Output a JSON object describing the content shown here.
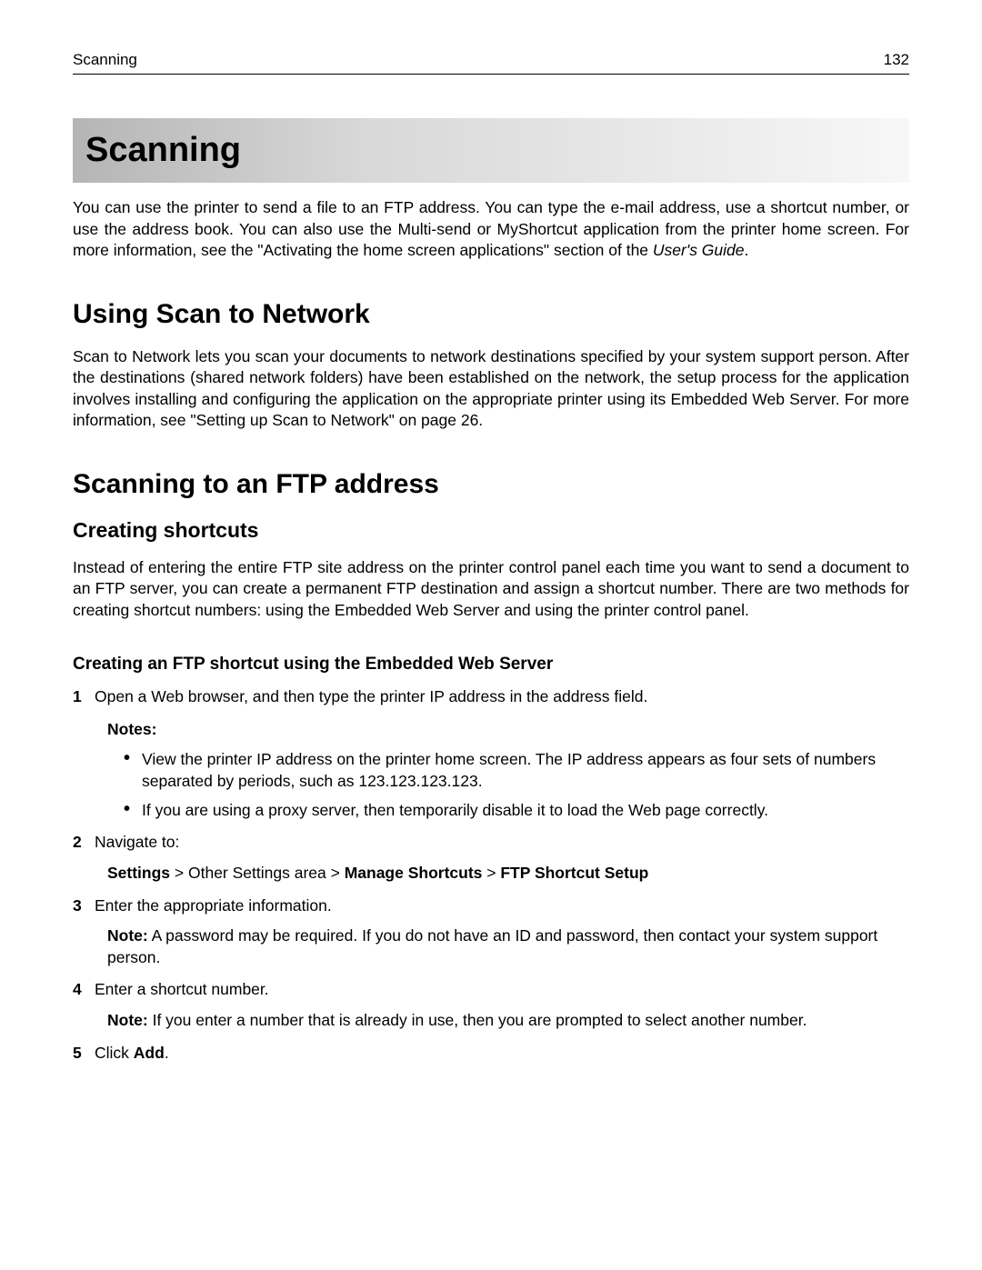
{
  "header": {
    "section": "Scanning",
    "page_number": "132"
  },
  "chapter_title": "Scanning",
  "intro_a": "You can use the printer to send a file to an FTP address. You can type the e‑mail address, use a shortcut number, or use the address book. You can also use the Multi‑send or MyShortcut application from the printer home screen. For more information, see the \"Activating the home screen applications\" section of the ",
  "intro_italic": "User's Guide",
  "intro_b": ".",
  "h1_a": "Using Scan to Network",
  "para_a": "Scan to Network lets you scan your documents to network destinations specified by your system support person. After the destinations (shared network folders) have been established on the network, the setup process for the application involves installing and configuring the application on the appropriate printer using its Embedded Web Server. For more information, see \"Setting up Scan to Network\" on page 26.",
  "h1_b": "Scanning to an FTP address",
  "h2_a": "Creating shortcuts",
  "para_b": "Instead of entering the entire FTP site address on the printer control panel each time you want to send a document to an FTP server, you can create a permanent FTP destination and assign a shortcut number. There are two methods for creating shortcut numbers: using the Embedded Web Server and using the printer control panel.",
  "h3_a": "Creating an FTP shortcut using the Embedded Web Server",
  "steps": {
    "s1": "Open a Web browser, and then type the printer IP address in the address field.",
    "notes_label": "Notes:",
    "bullet1": "View the printer IP address on the printer home screen. The IP address appears as four sets of numbers separated by periods, such as 123.123.123.123.",
    "bullet2": "If you are using a proxy server, then temporarily disable it to load the Web page correctly.",
    "s2": "Navigate to:",
    "nav_settings": "Settings",
    "nav_sep1": " > Other Settings area > ",
    "nav_manage": "Manage Shortcuts",
    "nav_sep2": " > ",
    "nav_ftp": "FTP Shortcut Setup",
    "s3": "Enter the appropriate information.",
    "s3_note_label": "Note:",
    "s3_note": " A password may be required. If you do not have an ID and password, then contact your system support person.",
    "s4": "Enter a shortcut number.",
    "s4_note_label": "Note:",
    "s4_note": " If you enter a number that is already in use, then you are prompted to select another number.",
    "s5_a": "Click ",
    "s5_bold": "Add",
    "s5_b": "."
  }
}
